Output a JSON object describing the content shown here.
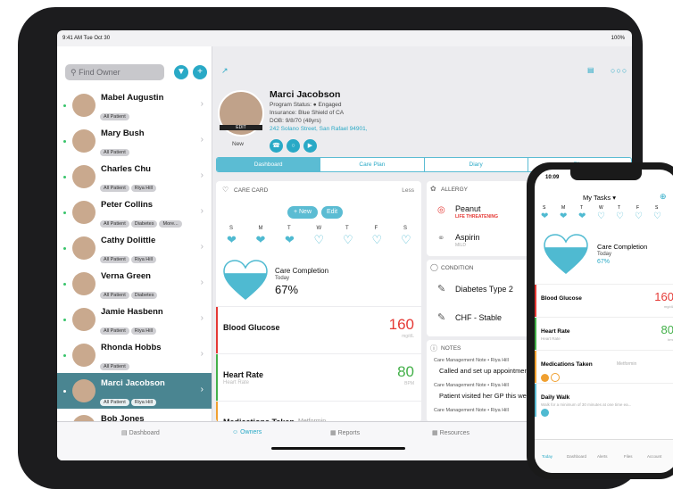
{
  "status": {
    "time": "9:41 AM  Tue Oct 30",
    "battery": "100%"
  },
  "sidebar": {
    "search_placeholder": "Find Owner",
    "patients": [
      {
        "name": "Mabel Augustin",
        "tags": [
          "All Patient"
        ]
      },
      {
        "name": "Mary Bush",
        "tags": [
          "All Patient"
        ]
      },
      {
        "name": "Charles Chu",
        "tags": [
          "All Patient",
          "Riya Hill"
        ]
      },
      {
        "name": "Peter Collins",
        "tags": [
          "All Patient",
          "Diabetes",
          "More..."
        ]
      },
      {
        "name": "Cathy Dolittle",
        "tags": [
          "All Patient",
          "Riya Hill"
        ]
      },
      {
        "name": "Verna Green",
        "tags": [
          "All Patient",
          "Diabetes"
        ]
      },
      {
        "name": "Jamie Hasbenn",
        "tags": [
          "All Patient",
          "Riya Hill"
        ]
      },
      {
        "name": "Rhonda Hobbs",
        "tags": [
          "All Patient"
        ]
      },
      {
        "name": "Marci Jacobson",
        "tags": [
          "All Patient",
          "Riya Hill"
        ],
        "selected": true
      },
      {
        "name": "Bob Jones",
        "tags": []
      }
    ]
  },
  "patient": {
    "name": "Marci Jacobson",
    "program_status": "Program Status:  ● Engaged",
    "insurance": "Insurance: Blue Shield of CA",
    "dob": "DOB: 9/8/70 (48yrs)",
    "address": "242 Solano Street, San Rafael 94901,",
    "edit": "EDIT",
    "new_label": "New"
  },
  "tabs": [
    "Dashboard",
    "Care Plan",
    "Diary",
    "Files"
  ],
  "care_card": {
    "title": "CARE CARD",
    "less": "Less",
    "new_button": "+ New",
    "edit_button": "Edit",
    "days": [
      "S",
      "M",
      "T",
      "W",
      "T",
      "F",
      "S"
    ],
    "completion_label": "Care Completion",
    "today": "Today",
    "completion_value": "67%"
  },
  "metrics": [
    {
      "label": "Blood Glucose",
      "sub": "",
      "value": "160",
      "unit": "mg/dL",
      "color": "#e53935"
    },
    {
      "label": "Heart Rate",
      "sub": "Heart Rate",
      "value": "80",
      "unit": "BPM",
      "color": "#43b049"
    },
    {
      "label": "Medications Taken",
      "sub": "Metformin",
      "value": "",
      "unit": "",
      "color": "#f0a030"
    }
  ],
  "allergy": {
    "title": "ALLERGY",
    "items": [
      {
        "name": "Peanut",
        "severity": "LIFE THREATENING"
      },
      {
        "name": "Aspirin",
        "severity": "MILD"
      }
    ]
  },
  "condition": {
    "title": "CONDITION",
    "items": [
      "Diabetes Type 2",
      "CHF - Stable"
    ]
  },
  "notes": {
    "title": "NOTES",
    "items": [
      {
        "meta": "Care Management Note • Riya Hill",
        "text": "Called and set up appointment for"
      },
      {
        "meta": "Care Management Note • Riya Hill",
        "text": "Patient visited her GP this week."
      },
      {
        "meta": "Care Management Note • Riya Hill",
        "text": ""
      }
    ]
  },
  "tabbar": [
    "Dashboard",
    "Owners",
    "Reports",
    "Resources"
  ],
  "phone": {
    "time": "10:09",
    "title": "My Tasks",
    "days": [
      "S",
      "M",
      "T",
      "W",
      "T",
      "F",
      "S"
    ],
    "completion_label": "Care Completion",
    "today": "Today",
    "completion_value": "67%",
    "metrics": [
      {
        "label": "Blood Glucose",
        "sub": "",
        "value": "160",
        "unit": "mg/dL",
        "color": "#e53935"
      },
      {
        "label": "Heart Rate",
        "sub": "Heart Rate",
        "value": "80",
        "unit": "bmr",
        "color": "#43b049"
      },
      {
        "label": "Medications Taken",
        "sub": "Metformin",
        "value": "",
        "unit": "",
        "color": "#f0a030"
      },
      {
        "label": "Daily Walk",
        "sub": "Walk for a minimum of 30 minutes at one time ea...",
        "value": "",
        "unit": "",
        "color": "#5bbcd3"
      }
    ],
    "tabbar": [
      "Today",
      "Dashboard",
      "Alerts",
      "Files",
      "Account"
    ]
  },
  "colors": {
    "accent": "#29a9c6",
    "selected_row": "#4a8591",
    "engaged": "#43b049"
  }
}
